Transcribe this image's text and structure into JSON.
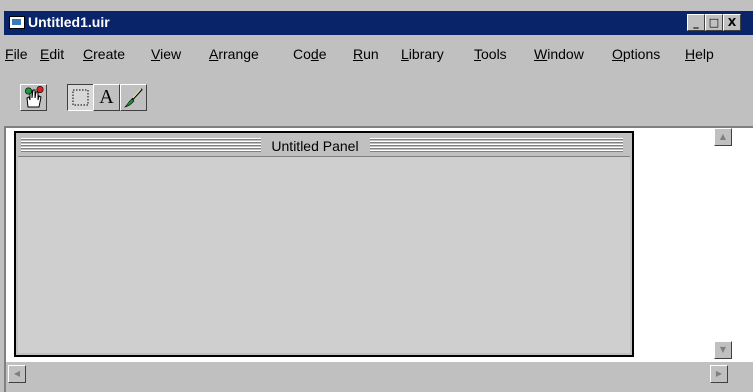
{
  "window": {
    "title": "Untitled1.uir",
    "minimize_glyph": "_",
    "maximize_glyph": "□",
    "close_glyph": "X"
  },
  "menu": {
    "items": [
      {
        "mnemonic": "F",
        "rest": "ile"
      },
      {
        "mnemonic": "E",
        "rest": "dit"
      },
      {
        "mnemonic": "C",
        "rest": "reate"
      },
      {
        "mnemonic": "V",
        "rest": "iew"
      },
      {
        "mnemonic": "A",
        "rest": "rrange"
      },
      {
        "pre": "Co",
        "mnemonic": "d",
        "rest": "e"
      },
      {
        "mnemonic": "R",
        "rest": "un"
      },
      {
        "mnemonic": "L",
        "rest": "ibrary"
      },
      {
        "mnemonic": "T",
        "rest": "ools"
      },
      {
        "mnemonic": "W",
        "rest": "indow"
      },
      {
        "mnemonic": "O",
        "rest": "ptions"
      },
      {
        "mnemonic": "H",
        "rest": "elp"
      }
    ]
  },
  "toolbar": {
    "buttons": [
      {
        "icon": "operate-hand-icon",
        "pressed": false
      },
      {
        "icon": "select-rectangle-icon",
        "pressed": true
      },
      {
        "icon": "text-tool-icon",
        "glyph": "A",
        "pressed": false
      },
      {
        "icon": "color-brush-icon",
        "pressed": false
      }
    ]
  },
  "panel": {
    "title": "Untitled Panel"
  },
  "scrollbars": {
    "up_glyph": "▲",
    "down_glyph": "▼",
    "left_glyph": "◀",
    "right_glyph": "▶"
  }
}
